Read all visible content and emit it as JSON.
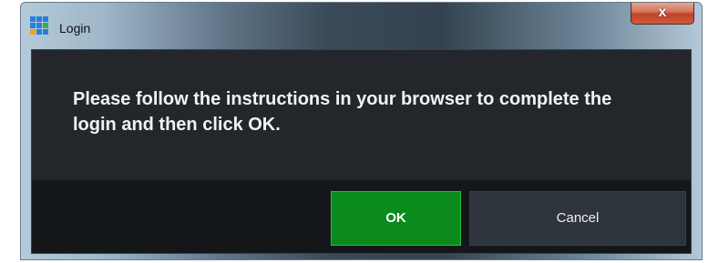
{
  "window": {
    "title": "Login",
    "close_label": "x"
  },
  "dialog": {
    "message": "Please follow the instructions in your browser to complete the login and then click OK.",
    "ok_label": "OK",
    "cancel_label": "Cancel"
  },
  "colors": {
    "ok_button": "#0b8a1e",
    "cancel_button": "#2e343b",
    "dialog_background": "#23272c",
    "close_button": "#c0432a"
  },
  "icons": {
    "app": "app-grid-icon",
    "close": "close-icon"
  }
}
